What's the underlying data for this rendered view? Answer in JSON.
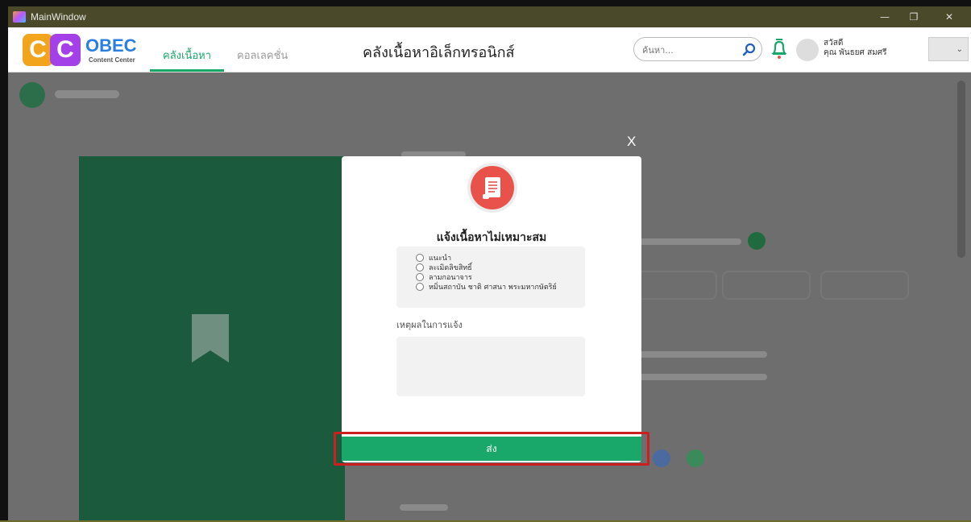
{
  "window": {
    "title": "MainWindow",
    "minimize": "—",
    "restore": "❐",
    "close": "✕"
  },
  "header": {
    "logo_letter_1": "C",
    "logo_letter_2": "C",
    "logo_brand": "OBEC",
    "logo_sub": "Content Center",
    "tabs": [
      {
        "label": "คลังเนื้อหา",
        "active": true
      },
      {
        "label": "คอลเลคชั่น",
        "active": false
      }
    ],
    "app_title": "คลังเนื้อหาอิเล็กทรอนิกส์",
    "search_placeholder": "ค้นหา...",
    "greeting": "สวัสดี",
    "user_name": "คุณ พันธยศ สมศรี",
    "dropdown_caret": "⌄"
  },
  "modal": {
    "close_label": "X",
    "title": "แจ้งเนื้อหาไม่เหมาะสม",
    "options": [
      "แนะนำ",
      "ละเมิดลิขสิทธิ์",
      "ลามกอนาจาร",
      "หมิ่นสถาบัน ชาติ ศาสนา พระมหากษัตริย์"
    ],
    "reason_label": "เหตุผลในการแจ้ง",
    "reason_value": "",
    "submit_label": "ส่ง"
  },
  "colors": {
    "accent_green": "#1aa86a",
    "report_red": "#e8524a",
    "highlight_red": "#cc2020"
  }
}
